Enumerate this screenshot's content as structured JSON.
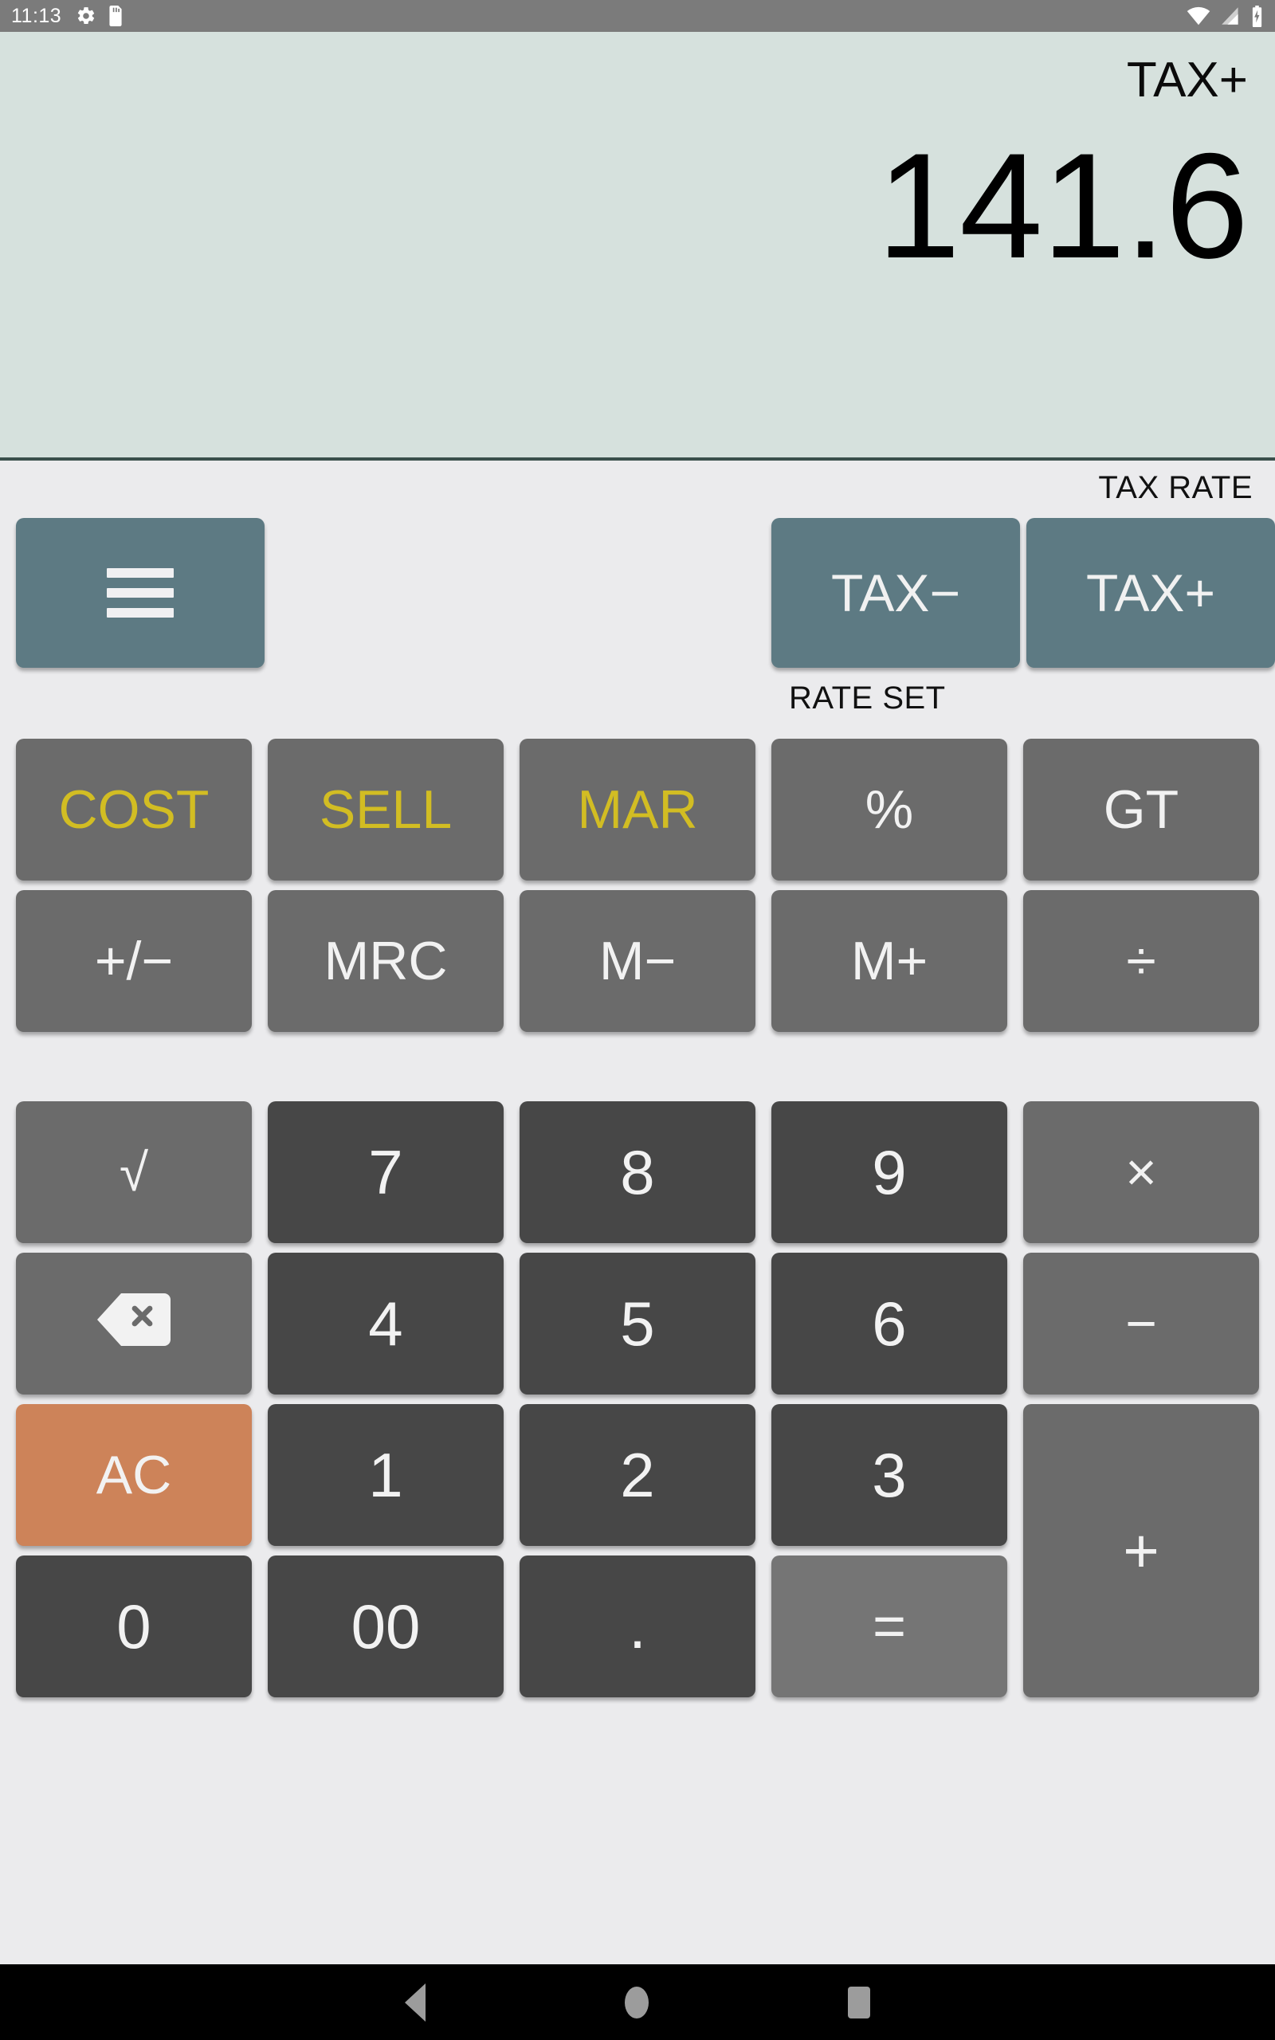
{
  "status_bar": {
    "time": "11:13",
    "left_icons": [
      "gear-icon",
      "sd-card-icon"
    ],
    "right_icons": [
      "wifi-icon",
      "cellular-signal-icon",
      "battery-charging-icon"
    ]
  },
  "display": {
    "mode_label": "TAX+",
    "value": "141.6",
    "background_color": "#d6e1dd"
  },
  "labels": {
    "tax_rate": "TAX RATE",
    "rate_set": "RATE SET"
  },
  "top_controls": {
    "menu_label": "",
    "menu_icon": "hamburger-menu-icon",
    "tax_minus": "TAX−",
    "tax_plus": "TAX+",
    "accent_color": "#5d7a83"
  },
  "keys": {
    "row1": [
      {
        "label": "COST",
        "style": "fn-gold"
      },
      {
        "label": "SELL",
        "style": "fn-gold"
      },
      {
        "label": "MAR",
        "style": "fn-gold"
      },
      {
        "label": "%",
        "style": "fn"
      },
      {
        "label": "GT",
        "style": "fn"
      }
    ],
    "row2": [
      {
        "label": "+/−",
        "style": "fn"
      },
      {
        "label": "MRC",
        "style": "fn"
      },
      {
        "label": "M−",
        "style": "fn"
      },
      {
        "label": "M+",
        "style": "fn"
      },
      {
        "label": "÷",
        "style": "fn"
      }
    ],
    "row3": [
      {
        "label": "√",
        "style": "fn"
      },
      {
        "label": "7",
        "style": "num"
      },
      {
        "label": "8",
        "style": "num"
      },
      {
        "label": "9",
        "style": "num"
      },
      {
        "label": "×",
        "style": "fn"
      }
    ],
    "row4": [
      {
        "label": "⌫",
        "style": "fn"
      },
      {
        "label": "4",
        "style": "num"
      },
      {
        "label": "5",
        "style": "num"
      },
      {
        "label": "6",
        "style": "num"
      },
      {
        "label": "−",
        "style": "fn"
      }
    ],
    "row5": [
      {
        "label": "AC",
        "style": "ac"
      },
      {
        "label": "1",
        "style": "num"
      },
      {
        "label": "2",
        "style": "num"
      },
      {
        "label": "3",
        "style": "num"
      },
      {
        "label": "+",
        "style": "fn"
      }
    ],
    "row6": [
      {
        "label": "0",
        "style": "num"
      },
      {
        "label": "00",
        "style": "num"
      },
      {
        "label": ".",
        "style": "num"
      },
      {
        "label": "=",
        "style": "eq"
      }
    ]
  },
  "colors": {
    "function_key": "#6b6b6b",
    "number_key": "#474747",
    "equals_key": "#757575",
    "clear_key": "#cd8359",
    "gold_text": "#d2bd23",
    "keypad_background": "#ebebed",
    "status_bar": "#7b7b7b",
    "nav_bar": "#000000"
  },
  "nav_bar": {
    "back": "back-icon",
    "home": "home-icon",
    "recents": "recents-icon"
  }
}
